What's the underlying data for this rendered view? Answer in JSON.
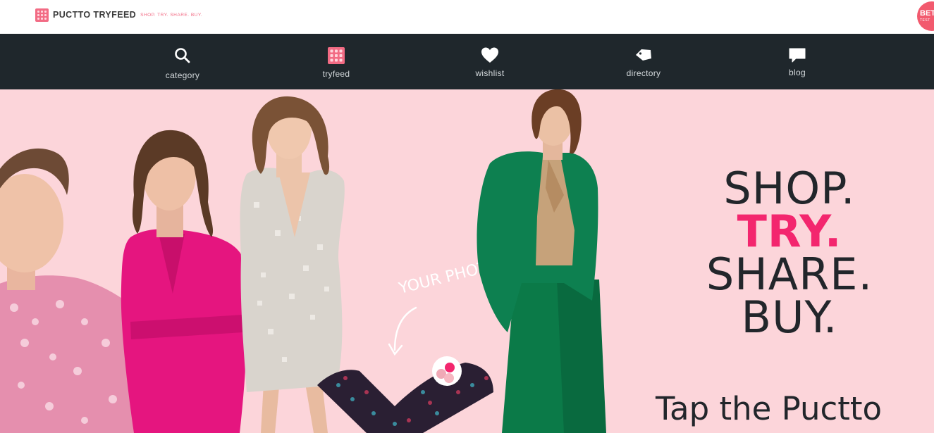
{
  "header": {
    "brand_name": "PUCTTO TRYFEED",
    "brand_tagline": "SHOP. TRY. SHARE. BUY.",
    "logo_icon": "grid-logo-icon",
    "beta_badge": "BETA",
    "beta_sub": "TEST"
  },
  "nav": {
    "items": [
      {
        "label": "category",
        "icon": "search-icon"
      },
      {
        "label": "tryfeed",
        "icon": "tryfeed-grid-icon"
      },
      {
        "label": "wishlist",
        "icon": "heart-icon"
      },
      {
        "label": "directory",
        "icon": "tag-icon"
      },
      {
        "label": "blog",
        "icon": "speech-bubble-icon"
      }
    ]
  },
  "hero": {
    "annotation": "YOUR PHOTO",
    "slogan": {
      "line1": "SHOP.",
      "line2": "TRY.",
      "line3": "SHARE.",
      "line4": "BUY."
    },
    "tagline": "Tap the Puctto",
    "colors": {
      "background": "#fcd5da",
      "accent": "#f3266e",
      "navbar": "#1f272c"
    }
  }
}
